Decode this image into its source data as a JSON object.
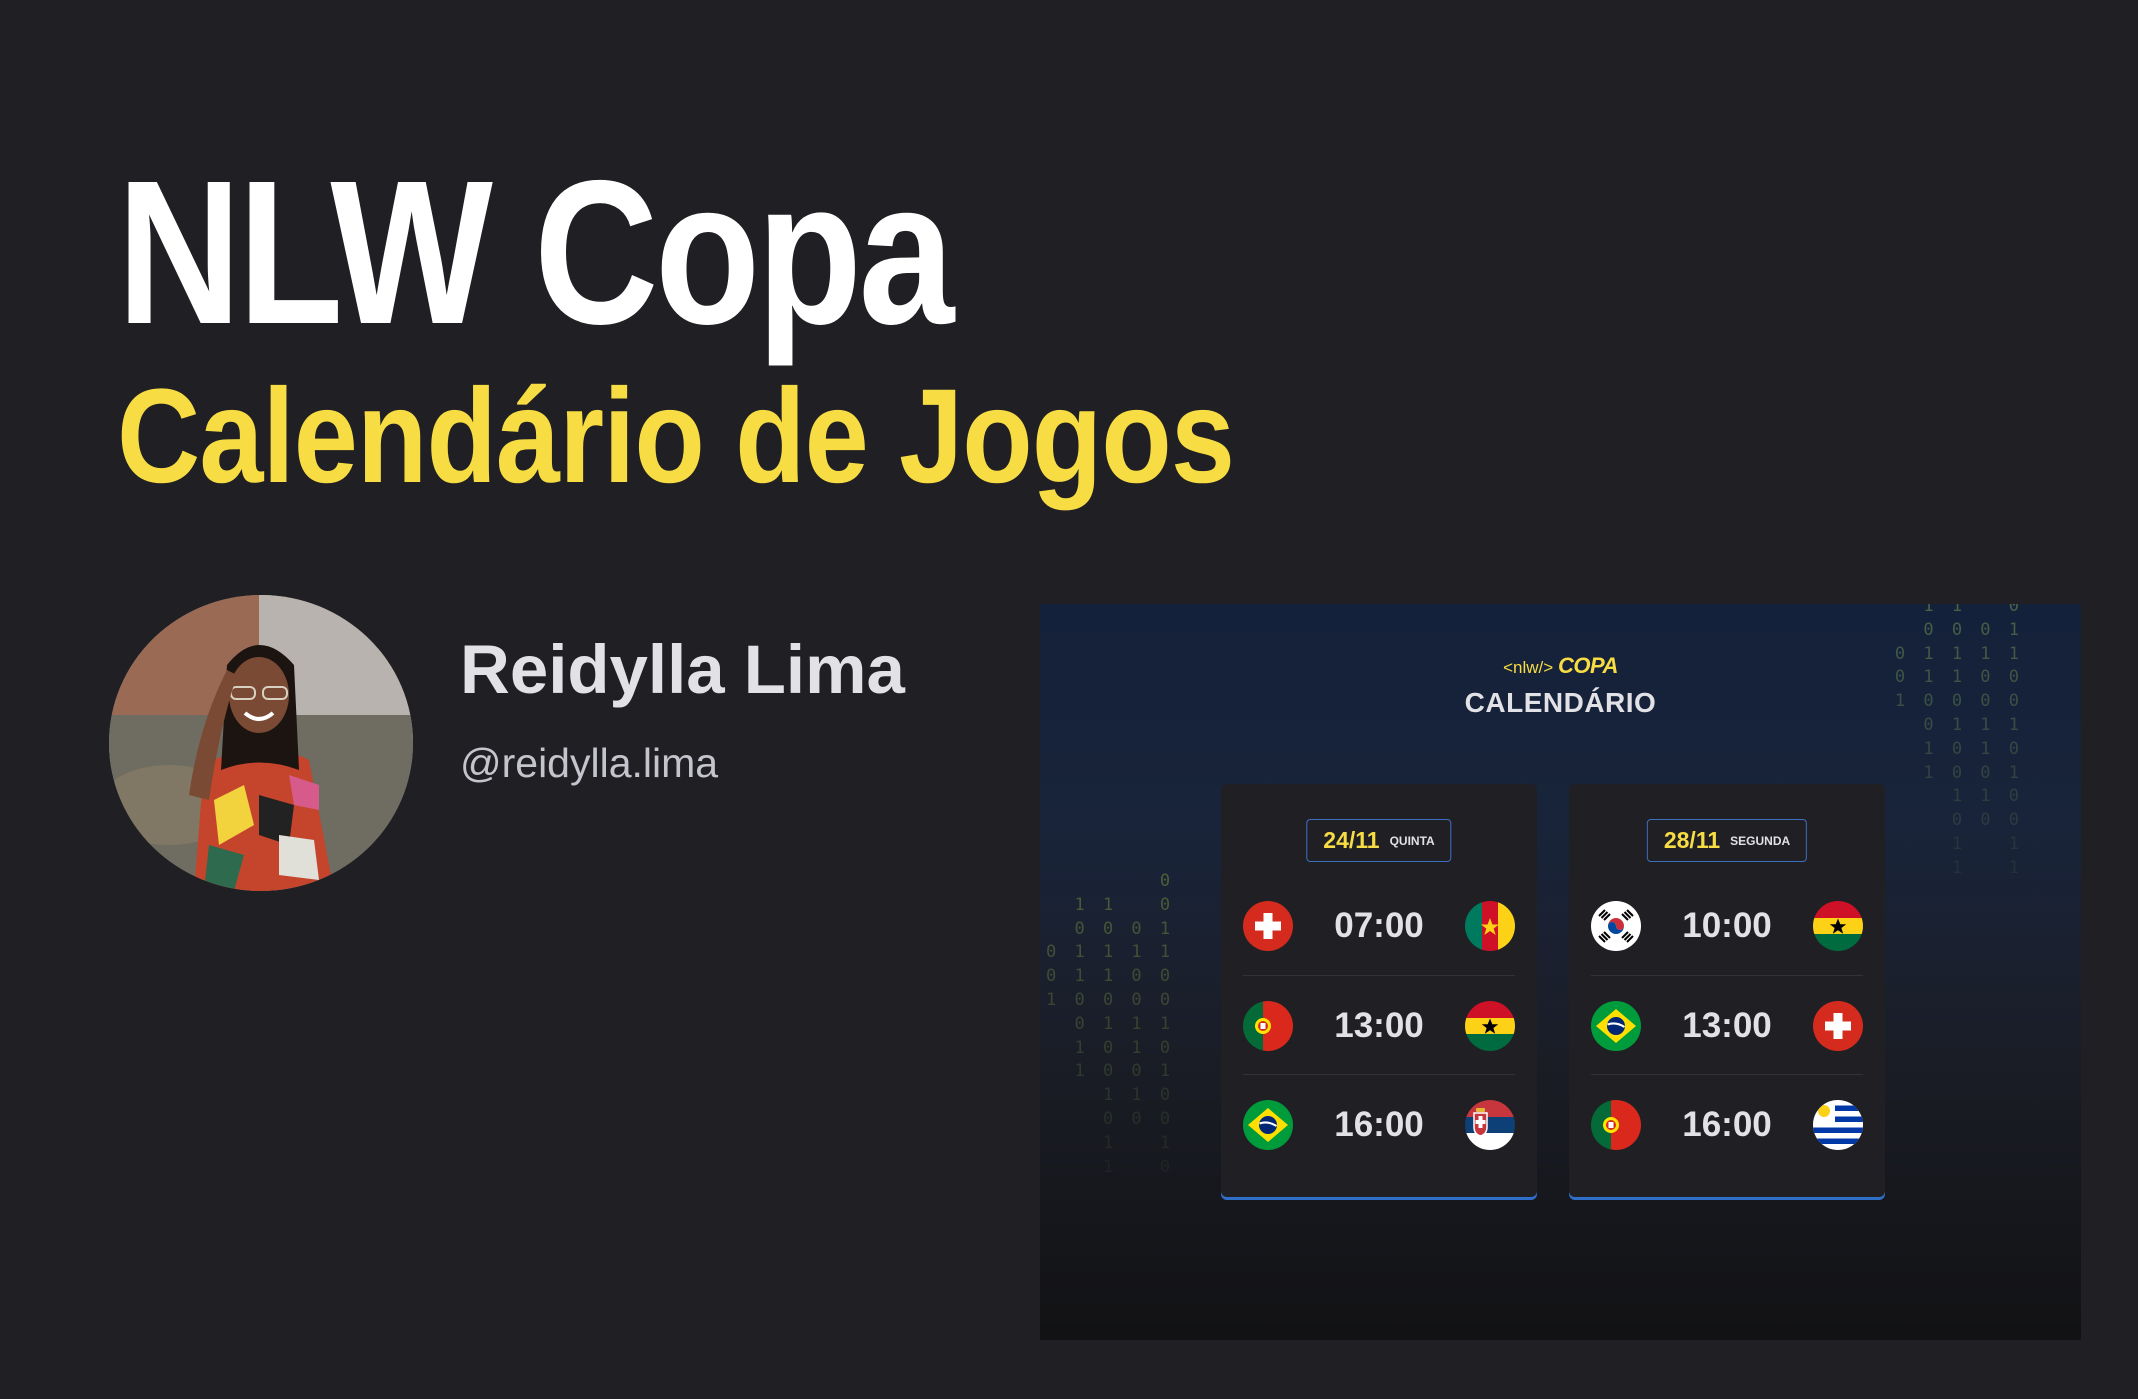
{
  "heading": {
    "title": "NLW Copa",
    "subtitle": "Calendário de Jogos"
  },
  "author": {
    "name": "Reidylla Lima",
    "handle": "@reidylla.lima"
  },
  "preview": {
    "logo_prefix": "<nlw/>",
    "logo_word": "COPA",
    "title": "CALENDÁRIO",
    "binary_right": [
      "1 1   0",
      "0 0 0 1",
      "0 1 1 1 1",
      "0 1 1 0 0",
      "1 0 0 0 0",
      "0 1 1 1",
      "1 0 1 0",
      "1 0 0 1",
      "1 1 0",
      "0 0 0",
      "1   1",
      "1   1"
    ],
    "binary_left": [
      "0",
      "1 1   0",
      "0 0 0 1",
      "0 1 1 1 1",
      "0 1 1 0 0",
      "1 0 0 0 0",
      "0 1 1 1",
      "1 0 1 0",
      "1 0 0 1",
      "1 1 0",
      "0 0 0",
      "1   1",
      "1   0"
    ],
    "cards": [
      {
        "date": "24/11",
        "weekday": "QUINTA",
        "matches": [
          {
            "home": "switzerland-flag-icon",
            "time": "07:00",
            "away": "cameroon-flag-icon"
          },
          {
            "home": "portugal-flag-icon",
            "time": "13:00",
            "away": "ghana-flag-icon"
          },
          {
            "home": "brazil-flag-icon",
            "time": "16:00",
            "away": "serbia-flag-icon"
          }
        ]
      },
      {
        "date": "28/11",
        "weekday": "SEGUNDA",
        "matches": [
          {
            "home": "south-korea-flag-icon",
            "time": "10:00",
            "away": "ghana-flag-icon"
          },
          {
            "home": "brazil-flag-icon",
            "time": "13:00",
            "away": "switzerland-flag-icon"
          },
          {
            "home": "portugal-flag-icon",
            "time": "16:00",
            "away": "uruguay-flag-icon"
          }
        ]
      }
    ]
  },
  "colors": {
    "background": "#202024",
    "accent_yellow": "#f7dd43",
    "card_border_blue": "#2f6ec9",
    "text_light": "#e1e1e6"
  }
}
